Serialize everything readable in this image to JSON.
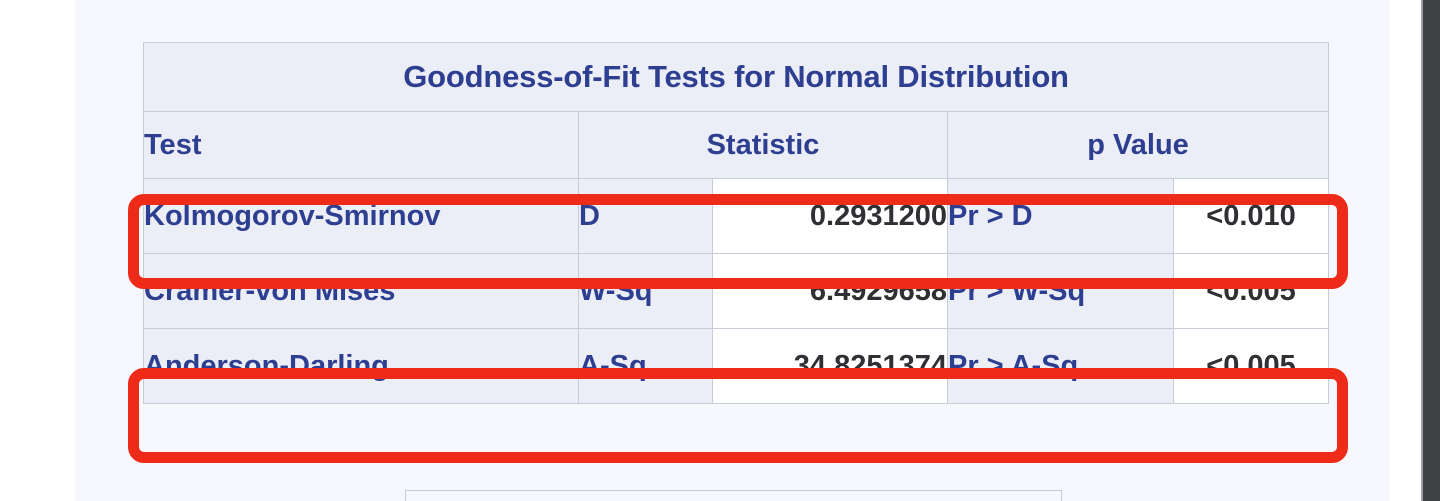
{
  "document": {
    "table": {
      "title": "Goodness-of-Fit Tests for Normal Distribution",
      "columns": {
        "test": "Test",
        "statistic": "Statistic",
        "p_value": "p Value"
      },
      "rows": [
        {
          "test": "Kolmogorov-Smirnov",
          "stat_symbol": "D",
          "stat_value": "0.2931200",
          "p_expression": "Pr > D",
          "p_value": "<0.010",
          "highlighted": true
        },
        {
          "test": "Cramer-von Mises",
          "stat_symbol": "W-Sq",
          "stat_value": "6.4929658",
          "p_expression": "Pr > W-Sq",
          "p_value": "<0.005",
          "highlighted": false
        },
        {
          "test": "Anderson-Darling",
          "stat_symbol": "A-Sq",
          "stat_value": "34.8251374",
          "p_expression": "Pr > A-Sq",
          "p_value": "<0.005",
          "highlighted": true
        }
      ]
    },
    "annotations": [
      {
        "name": "kolmogorov-smirnov-row-highlight",
        "color": "#ee2b18",
        "shape": "rounded-rectangle"
      },
      {
        "name": "anderson-darling-row-highlight",
        "color": "#ee2b18",
        "shape": "rounded-rectangle"
      }
    ],
    "colors": {
      "header_text": "#2e3e90",
      "header_background": "#ebeef6",
      "cell_background": "#ffffff",
      "cell_text": "#2f2f34",
      "grid_line": "#c8ccd8",
      "page_background": "#f7f8fd",
      "highlight": "#ee2b18"
    }
  }
}
